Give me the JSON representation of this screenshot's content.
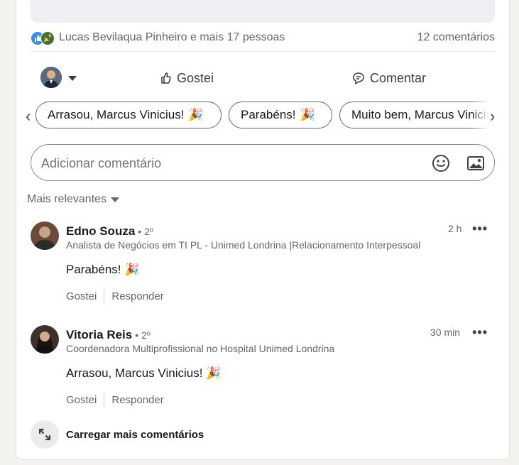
{
  "social": {
    "reactions_text": "Lucas Bevilaqua Pinheiro e mais 17 pessoas",
    "comments_count": "12 comentários"
  },
  "actions": {
    "like_label": "Gostei",
    "comment_label": "Comentar"
  },
  "suggestions": {
    "left_arrow": "‹",
    "right_arrow": "›",
    "chips": [
      {
        "text": "Arrasou, Marcus Vinicius!",
        "emoji": "🎉"
      },
      {
        "text": "Parabéns!",
        "emoji": "🎉"
      },
      {
        "text": "Muito bem, Marcus Vinicius!",
        "emoji": ""
      }
    ]
  },
  "comment_box": {
    "placeholder": "Adicionar comentário"
  },
  "sort": {
    "label": "Mais relevantes"
  },
  "comments": [
    {
      "name": "Edno Souza",
      "degree": "• 2º",
      "headline": "Analista de Negócios em TI PL - Unimed Londrina |Relacionamento Interpessoal",
      "time": "2 h",
      "text": "Parabéns! 🎉",
      "like_label": "Gostei",
      "reply_label": "Responder"
    },
    {
      "name": "Vitoria Reis",
      "degree": "• 2º",
      "headline": "Coordenadora Multiprofissional no Hospital Unimed Londrina",
      "time": "30 min",
      "text": "Arrasou, Marcus Vinicius! 🎉",
      "like_label": "Gostei",
      "reply_label": "Responder"
    }
  ],
  "more_menu": "•••",
  "load_more": {
    "label": "Carregar mais comentários"
  },
  "colors": {
    "like_blue": "#378fe9",
    "celebrate_green": "#44712e",
    "background": "#f4f2ee"
  }
}
